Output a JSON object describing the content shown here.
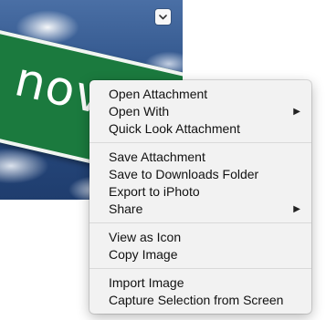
{
  "attachment": {
    "sign_text": "novat"
  },
  "menu": {
    "groups": [
      [
        {
          "label": "Open Attachment"
        },
        {
          "label": "Open With"
        },
        {
          "label": "Quick Look Attachment"
        }
      ],
      [
        {
          "label": "Save Attachment"
        },
        {
          "label": "Save to Downloads Folder"
        },
        {
          "label": "Export to iPhoto"
        },
        {
          "label": "Share"
        }
      ],
      [
        {
          "label": "View as Icon"
        },
        {
          "label": "Copy Image"
        }
      ],
      [
        {
          "label": "Import Image"
        },
        {
          "label": "Capture Selection from Screen"
        }
      ]
    ]
  },
  "icons": {
    "submenu_arrow": "▶"
  }
}
